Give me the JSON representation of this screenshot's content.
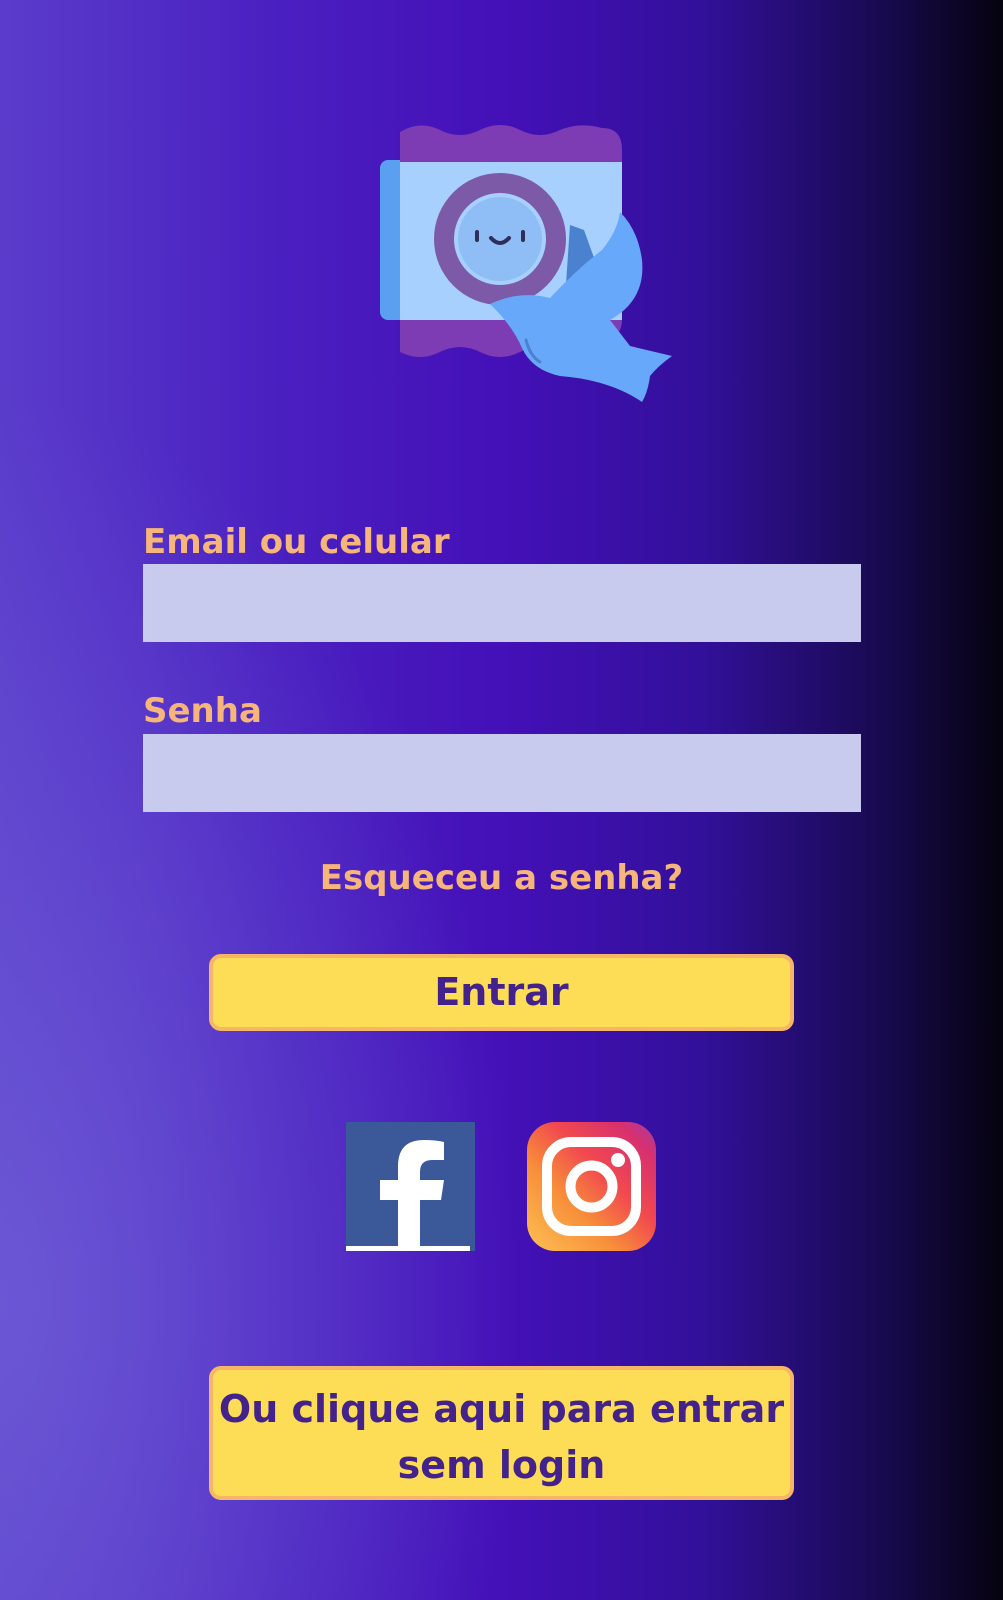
{
  "form": {
    "email_label": "Email ou celular",
    "email_value": "",
    "password_label": "Senha",
    "password_value": "",
    "forgot_password": "Esqueceu a senha?",
    "enter_button": "Entrar"
  },
  "social": {
    "facebook_icon": "facebook-icon",
    "instagram_icon": "instagram-icon"
  },
  "guest": {
    "line1": "Ou clique aqui para entrar",
    "line2": "sem login"
  },
  "colors": {
    "label": "#f6b57a",
    "input_bg": "#c9cbee",
    "button_bg": "#fedd56",
    "button_border": "#f5b668",
    "button_text": "#43238b"
  }
}
